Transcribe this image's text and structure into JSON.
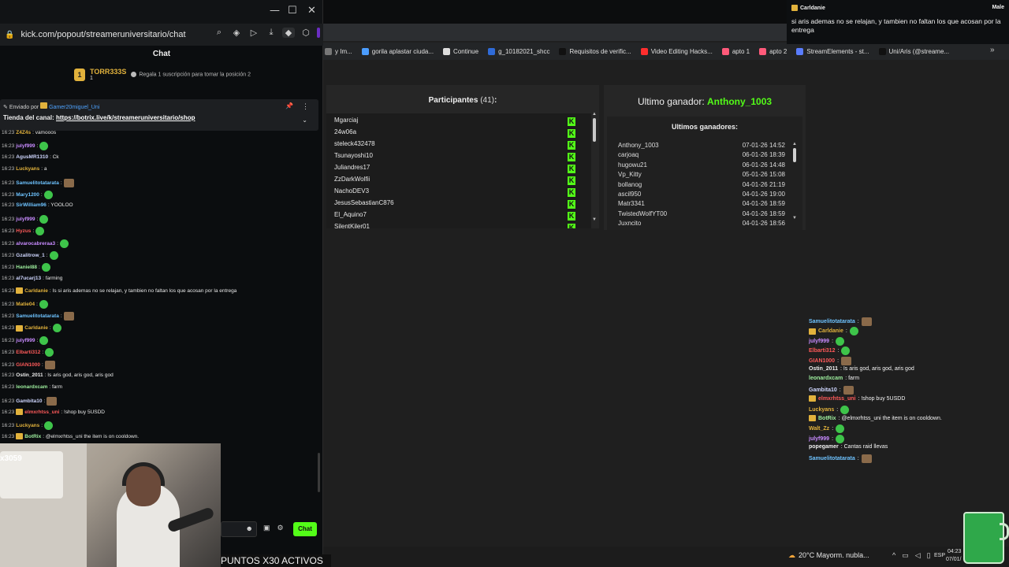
{
  "popout": {
    "window_controls": {
      "minimize": "—",
      "maximize": "☐",
      "close": "✕"
    },
    "url": "kick.com/popout/streameruniversitario/chat",
    "chat_title": "Chat",
    "top_gifter": {
      "rank": "1",
      "name": "TORR333S",
      "count": "1",
      "hint": "Regala 1 suscripción para tomar la posición 2"
    },
    "pinned": {
      "by_label": "Enviado por",
      "by_user": "Gamer20miguel_Uni",
      "message_prefix": "Tienda del canal:",
      "link": "https://botrix.live/k/streameruniversitario/shop"
    },
    "messages": [
      {
        "ts": "16:23",
        "name": "Z4Z4s",
        "color": "#e2b23c",
        "text": ": vamooos"
      },
      {
        "ts": "16:23",
        "name": "julyf999",
        "color": "#c88bff",
        "text": ":",
        "emote": true
      },
      {
        "ts": "16:23",
        "name": "AgusMR1310",
        "color": "#cfd6ff",
        "text": ": Ck"
      },
      {
        "ts": "16:23",
        "name": "Luckyans",
        "color": "#e2b23c",
        "text": ": a"
      },
      {
        "ts": "16:23",
        "name": "Samuelitotatarata",
        "color": "#6ec3ff",
        "text": ":",
        "emote_sq": true
      },
      {
        "ts": "16:23",
        "name": "Mary1200",
        "color": "#6ec3ff",
        "text": ":",
        "emote": true
      },
      {
        "ts": "16:23",
        "name": "SirWilliam96",
        "color": "#6ec3ff",
        "text": ": YOOLOO"
      },
      {
        "ts": "16:23",
        "name": "julyf999",
        "color": "#c88bff",
        "text": ":",
        "emote": true
      },
      {
        "ts": "16:23",
        "name": "Hyzus",
        "color": "#ff5a5a",
        "text": ":",
        "emote": true
      },
      {
        "ts": "16:23",
        "name": "alvarocabreraa3",
        "color": "#c88bff",
        "text": ":",
        "emote": true
      },
      {
        "ts": "16:23",
        "name": "Gzalitrow_1",
        "color": "#cfd6ff",
        "text": ":",
        "emote": true
      },
      {
        "ts": "16:23",
        "name": "Haniel88",
        "color": "#9ff09f",
        "text": ":",
        "emote": true
      },
      {
        "ts": "16:23",
        "name": "al7ucarj13",
        "color": "#cfd6ff",
        "text": ": farming"
      },
      {
        "ts": "16:23",
        "name": "Carldanie",
        "color": "#e2b23c",
        "text": ": Is si aris ademas no se relajan, y tambien no faltan los que acosan por la entrega",
        "badge": true
      },
      {
        "ts": "16:23",
        "name": "Matie04",
        "color": "#e2b23c",
        "text": ":",
        "emote": true
      },
      {
        "ts": "16:23",
        "name": "Samuelitotatarata",
        "color": "#6ec3ff",
        "text": ":",
        "emote_sq": true
      },
      {
        "ts": "16:23",
        "name": "Carldanie",
        "color": "#e2b23c",
        "text": ":",
        "badge": true,
        "emote": true
      },
      {
        "ts": "16:23",
        "name": "julyf999",
        "color": "#c88bff",
        "text": ":",
        "emote": true
      },
      {
        "ts": "16:23",
        "name": "Elbarti312",
        "color": "#ff5a5a",
        "text": ":",
        "emote": true
      },
      {
        "ts": "16:23",
        "name": "GIAN1000",
        "color": "#ff5a5a",
        "text": ":",
        "emote_sq": true
      },
      {
        "ts": "16:23",
        "name": "Ostin_2011",
        "color": "#f0f0f0",
        "text": ": Is aris god, aris god, aris god"
      },
      {
        "ts": "16:23",
        "name": "leonardxcam",
        "color": "#9ff09f",
        "text": ": farm"
      },
      {
        "ts": "16:23",
        "name": "Gambita10",
        "color": "#cfd6ff",
        "text": ":",
        "emote_sq": true
      },
      {
        "ts": "16:23",
        "name": "elmxrhtss_uni",
        "color": "#ff5a5a",
        "text": ": !shop buy 5USDD",
        "badge": true
      },
      {
        "ts": "16:23",
        "name": "Luckyans",
        "color": "#e2b23c",
        "text": ":",
        "emote": true
      },
      {
        "ts": "16:23",
        "name": "BotRix",
        "color": "#9ff09f",
        "text": ": @elmxrhtss_uni the item is on cooldown.",
        "badge": true
      }
    ],
    "cam_logo_text": "x3059",
    "chat_button": "Chat",
    "ticker": "PUNTOS X30 ACTIVOS"
  },
  "browser": {
    "bookmarks": [
      {
        "label": "y Im...",
        "color": "#777777"
      },
      {
        "label": "gorila aplastar ciuda...",
        "color": "#4b9dff"
      },
      {
        "label": "Continue",
        "color": "#dddddd"
      },
      {
        "label": "g_10182021_shcc",
        "color": "#2f6bd8"
      },
      {
        "label": "Requisitos de verific...",
        "color": "#111111"
      },
      {
        "label": "Video Editing Hacks...",
        "color": "#ff2e2e"
      },
      {
        "label": "apto 1",
        "color": "#ff5a7a"
      },
      {
        "label": "apto 2",
        "color": "#ff5a7a"
      },
      {
        "label": "StreamElements - st...",
        "color": "#5a7dff"
      },
      {
        "label": "Uni/Aris (@streame...",
        "color": "#111111"
      }
    ],
    "bookmarks_more": "»",
    "participants": {
      "title": "Participantes",
      "count": "(41)",
      "colon": ":",
      "names": [
        "Mgarciaj",
        "24w06a",
        "steleck432478",
        "Tsunayoshi10",
        "Juliandres17",
        "ZzDarkWolfii",
        "NachoDEV3",
        "JesusSebastianC876",
        "El_Aquino7",
        "SilentKiler01"
      ]
    },
    "last_winner": {
      "label": "Ultimo ganador:",
      "name": "Anthony_1003"
    },
    "winners": {
      "title": "Ultimos ganadores:",
      "rows": [
        {
          "name": "Anthony_1003",
          "date": "07-01-26 14:52"
        },
        {
          "name": "carjoaq",
          "date": "06-01-26 18:39"
        },
        {
          "name": "hugowu21",
          "date": "06-01-26 14:48"
        },
        {
          "name": "Vp_Kitty",
          "date": "05-01-26 15:08"
        },
        {
          "name": "bollanog",
          "date": "04-01-26 21:19"
        },
        {
          "name": "ascil950",
          "date": "04-01-26 19:00"
        },
        {
          "name": "Matr3341",
          "date": "04-01-26 18:59"
        },
        {
          "name": "TwistedWolfYT00",
          "date": "04-01-26 18:59"
        },
        {
          "name": "Juxncito",
          "date": "04-01-26 18:56"
        }
      ]
    }
  },
  "notification": {
    "user": "Carldanie",
    "right": "Male",
    "body": "si aris ademas no se relajan, y tambien no faltan los que acosan por la entrega"
  },
  "overlay_chat": [
    {
      "name": "Samuelitotatarata",
      "color": "#6ec3ff",
      "text": ":",
      "emote_sq": true
    },
    {
      "name": "Carldanie",
      "color": "#e2b23c",
      "text": ":",
      "badge": true,
      "emote": true
    },
    {
      "name": "julyf999",
      "color": "#c88bff",
      "text": ":",
      "emote": true
    },
    {
      "name": "Elbarti312",
      "color": "#ff5a5a",
      "text": ":",
      "emote": true
    },
    {
      "name": "GIAN1000",
      "color": "#ff5a5a",
      "text": ":",
      "emote_sq": true
    },
    {
      "name": "Ostin_2011",
      "color": "#f0f0f0",
      "text": ": Is aris god, aris god, aris god"
    },
    {
      "name": "leonardxcam",
      "color": "#9ff09f",
      "text": ": farm"
    },
    {
      "name": "Gambita10",
      "color": "#cfd6ff",
      "text": ":",
      "emote_sq": true
    },
    {
      "name": "elmxrhtss_uni",
      "color": "#ff5a5a",
      "text": ": !shop buy 5USDD",
      "badge": true
    },
    {
      "name": "Luckyans",
      "color": "#e2b23c",
      "text": ":",
      "emote": true
    },
    {
      "name": "BotRix",
      "color": "#9ff09f",
      "text": ": @elmxrhtss_uni the item is on cooldown.",
      "badge": true
    },
    {
      "name": "Walt_Zz",
      "color": "#e2b23c",
      "text": ":",
      "emote": true
    },
    {
      "name": "julyf999",
      "color": "#c88bff",
      "text": ":",
      "emote": true
    },
    {
      "name": "popegamer",
      "color": "#f0f0f0",
      "text": ": Cantas raid llevas"
    },
    {
      "name": "Samuelitotatarata",
      "color": "#6ec3ff",
      "text": ":",
      "emote_sq": true
    }
  ],
  "taskbar": {
    "weather": "20°C  Mayorm. nubla...",
    "lang": "ESP",
    "time": "04:23",
    "date": "07/01/"
  }
}
